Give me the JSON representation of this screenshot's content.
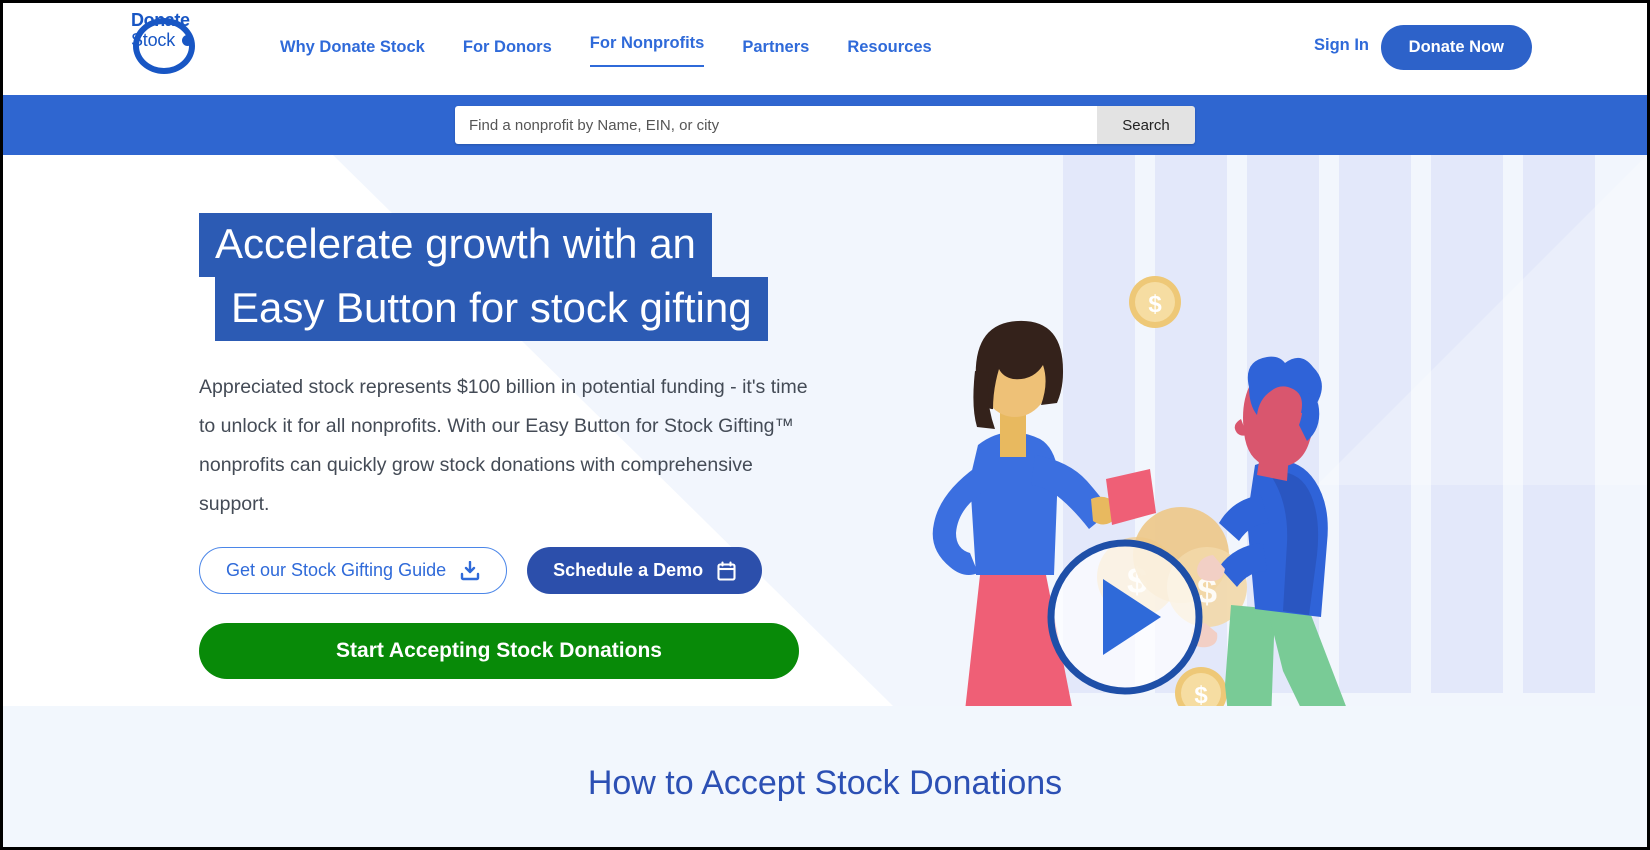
{
  "header": {
    "logo": {
      "line1": "Donate",
      "line2": "Stock"
    },
    "nav": [
      {
        "label": "Why Donate Stock",
        "active": false
      },
      {
        "label": "For Donors",
        "active": false
      },
      {
        "label": "For Nonprofits",
        "active": true
      },
      {
        "label": "Partners",
        "active": false
      },
      {
        "label": "Resources",
        "active": false
      }
    ],
    "sign_in": "Sign In",
    "donate_now": "Donate Now"
  },
  "search": {
    "placeholder": "Find a nonprofit by Name, EIN, or city",
    "value": "",
    "button": "Search"
  },
  "hero": {
    "headline_line1": "Accelerate growth with an",
    "headline_line2": "Easy Button for stock gifting",
    "body": "Appreciated stock represents $100 billion in potential funding - it's time to unlock it for all nonprofits. With our Easy Button for Stock Gifting™ nonprofits can quickly grow stock donations with comprehensive support.",
    "btn_guide": "Get our Stock Gifting Guide",
    "btn_demo": "Schedule a Demo",
    "btn_start": "Start Accepting Stock Donations",
    "video_play": "play-video"
  },
  "section2": {
    "title": "How to Accept Stock Donations"
  },
  "colors": {
    "brand_blue": "#2f6ad9",
    "nav_blue": "#2f66d0",
    "headline_block": "#2c5bb4",
    "deep_blue": "#2c4fab",
    "green": "#088a08",
    "light_blue_bg": "#f2f6fd",
    "stripe": "#e3e8fa",
    "section_bg": "#f2f7fd"
  }
}
